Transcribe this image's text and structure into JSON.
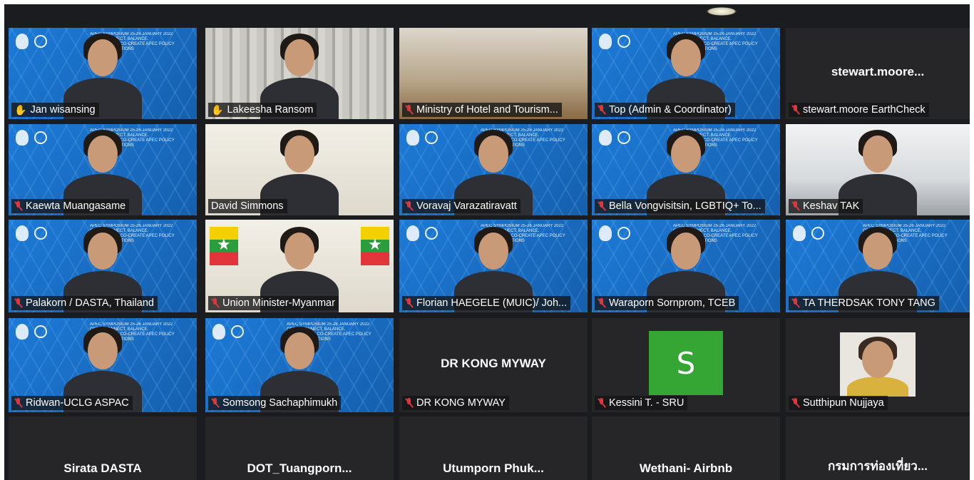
{
  "meeting": {
    "banner_lines": [
      "APEC SYMPOSIUM 25-26 JANUARY 2022",
      "OPEN. CONNECT. BALANCE.",
      "DIALOGUE TO CO-CREATE APEC POLICY RECOMMENDATIONS"
    ],
    "participants": [
      {
        "name": "Jan wisansing",
        "status": "hand-raised",
        "bg": "blue",
        "active": true
      },
      {
        "name": "Lakeesha Ransom",
        "status": "hand-raised",
        "bg": "curtain"
      },
      {
        "name": "Ministry of Hotel and Tourism...",
        "status": "muted",
        "bg": "room"
      },
      {
        "name": "Top (Admin & Coordinator)",
        "status": "muted",
        "bg": "blue"
      },
      {
        "name": "stewart.moore EarthCheck",
        "status": "muted",
        "bg": "none",
        "center_name": "stewart.moore..."
      },
      {
        "name": "Kaewta Muangasame",
        "status": "muted",
        "bg": "blue"
      },
      {
        "name": "David Simmons",
        "status": "none",
        "bg": "beige"
      },
      {
        "name": "Voravaj Varazatiravatt",
        "status": "muted",
        "bg": "blue"
      },
      {
        "name": "Bella Vongvisitsin, LGBTIQ+ To...",
        "status": "muted",
        "bg": "blue"
      },
      {
        "name": "Keshav TAK",
        "status": "muted",
        "bg": "office"
      },
      {
        "name": "Palakorn / DASTA, Thailand",
        "status": "muted",
        "bg": "blue"
      },
      {
        "name": "Union Minister-Myanmar",
        "status": "muted",
        "bg": "beige"
      },
      {
        "name": "Florian HAEGELE (MUIC)/ Joh...",
        "status": "muted",
        "bg": "blue"
      },
      {
        "name": "Waraporn Sornprom, TCEB",
        "status": "muted",
        "bg": "blue"
      },
      {
        "name": "TA THERDSAK TONY TANG",
        "status": "muted",
        "bg": "blue"
      },
      {
        "name": "Ridwan-UCLG ASPAC",
        "status": "muted",
        "bg": "blue"
      },
      {
        "name": "Somsong Sachaphimukh",
        "status": "muted",
        "bg": "blue"
      },
      {
        "name": "DR KONG MYWAY",
        "status": "muted",
        "bg": "none",
        "center_name": "DR KONG MYWAY"
      },
      {
        "name": "Kessini T. - SRU",
        "status": "muted",
        "bg": "none",
        "avatar_letter": "S"
      },
      {
        "name": "Sutthipun Nujjaya",
        "status": "muted",
        "bg": "none",
        "avatar": "photo"
      },
      {
        "center_name": "Sirata DASTA",
        "bg": "none"
      },
      {
        "center_name": "DOT_Tuangporn...",
        "bg": "none"
      },
      {
        "center_name": "Utumporn  Phuk...",
        "bg": "none"
      },
      {
        "center_name": "Wethani- Airbnb",
        "bg": "none"
      },
      {
        "center_name": "กรมการท่องเที่ยว...",
        "bg": "none"
      }
    ]
  },
  "icons": {
    "muted": "mic-muted-icon",
    "hand": "raised-hand-icon"
  },
  "colors": {
    "tile_bg": "#262629",
    "banner_blue": "#1a6fc4",
    "active_border": "#d7d83a",
    "muted_red": "#e2343b",
    "avatar_green": "#35a534"
  }
}
